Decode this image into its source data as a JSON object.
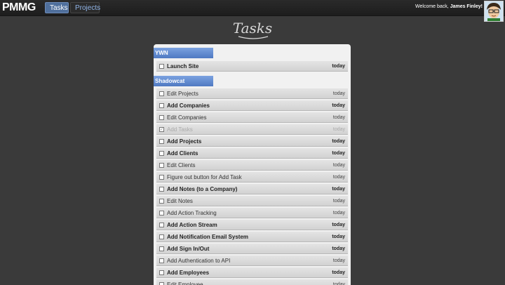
{
  "header": {
    "logo_text": "PMMG",
    "logo_small": "",
    "nav_tasks": "Tasks",
    "nav_projects": "Projects",
    "welcome_prefix": "Welcome back, ",
    "welcome_name": "James Finley!"
  },
  "page": {
    "title": "Tasks"
  },
  "colors": {
    "accent": "#4f79c2",
    "nav_active": "#4f6f9c",
    "background": "#3a3a3a"
  },
  "groups": [
    {
      "name": "YWN"
    },
    {
      "name": "Shadowcat"
    }
  ],
  "tasks": [
    {
      "label": "Launch Site",
      "due": "today",
      "bold": true,
      "done": false
    },
    {
      "label": "Edit Projects",
      "due": "today",
      "bold": false,
      "done": false
    },
    {
      "label": "Add Companies",
      "due": "today",
      "bold": true,
      "done": false
    },
    {
      "label": "Edit Companies",
      "due": "today",
      "bold": false,
      "done": false
    },
    {
      "label": "Add Tasks",
      "due": "today",
      "bold": false,
      "done": true
    },
    {
      "label": "Add Projects",
      "due": "today",
      "bold": true,
      "done": false
    },
    {
      "label": "Add Clients",
      "due": "today",
      "bold": true,
      "done": false
    },
    {
      "label": "Edit Clients",
      "due": "today",
      "bold": false,
      "done": false
    },
    {
      "label": "Figure out button for Add Task",
      "due": "today",
      "bold": false,
      "done": false
    },
    {
      "label": "Add Notes (to a Company)",
      "due": "today",
      "bold": true,
      "done": false
    },
    {
      "label": "Edit Notes",
      "due": "today",
      "bold": false,
      "done": false
    },
    {
      "label": "Add Action Tracking",
      "due": "today",
      "bold": false,
      "done": false
    },
    {
      "label": "Add Action Stream",
      "due": "today",
      "bold": true,
      "done": false
    },
    {
      "label": "Add Notification Email System",
      "due": "today",
      "bold": true,
      "done": false
    },
    {
      "label": "Add Sign In/Out",
      "due": "today",
      "bold": true,
      "done": false
    },
    {
      "label": "Add Authentication to API",
      "due": "today",
      "bold": false,
      "done": false
    },
    {
      "label": "Add Employees",
      "due": "today",
      "bold": true,
      "done": false
    },
    {
      "label": "Edit Employee",
      "due": "today",
      "bold": false,
      "done": false
    }
  ]
}
